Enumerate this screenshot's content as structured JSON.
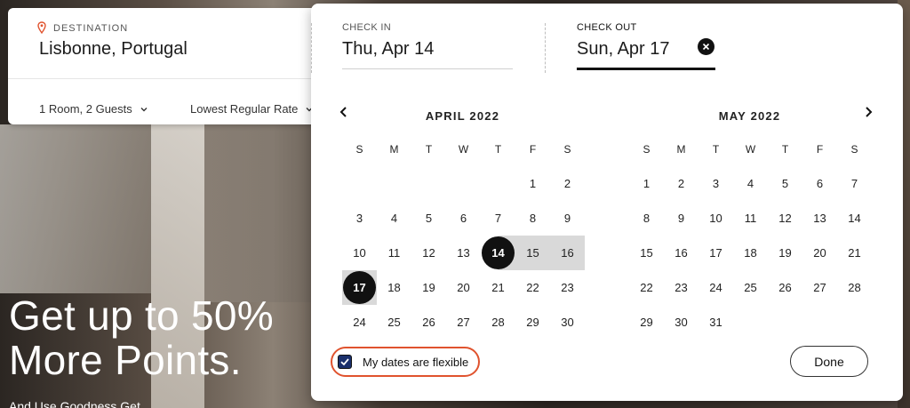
{
  "search": {
    "destination_label": "DESTINATION",
    "destination_value": "Lisbonne, Portugal",
    "rooms_guests": "1 Room, 2 Guests",
    "rate": "Lowest Regular Rate"
  },
  "hero": {
    "line1": "Get up to 50%",
    "line2": "More Points.",
    "sub": "And Use Goodness Get..."
  },
  "picker": {
    "check_in_label": "CHECK IN",
    "check_in_value": "Thu, Apr 14",
    "check_out_label": "CHECK OUT",
    "check_out_value": "Sun, Apr 17",
    "months": [
      {
        "title": "APRIL 2022",
        "weekdays": [
          "S",
          "M",
          "T",
          "W",
          "T",
          "F",
          "S"
        ],
        "weeks": [
          [
            "",
            "",
            "",
            "",
            "",
            "1",
            "2"
          ],
          [
            "3",
            "4",
            "5",
            "6",
            "7",
            "8",
            "9"
          ],
          [
            "10",
            "11",
            "12",
            "13",
            "14",
            "15",
            "16"
          ],
          [
            "17",
            "18",
            "19",
            "20",
            "21",
            "22",
            "23"
          ],
          [
            "24",
            "25",
            "26",
            "27",
            "28",
            "29",
            "30"
          ]
        ]
      },
      {
        "title": "MAY 2022",
        "weekdays": [
          "S",
          "M",
          "T",
          "W",
          "T",
          "F",
          "S"
        ],
        "weeks": [
          [
            "1",
            "2",
            "3",
            "4",
            "5",
            "6",
            "7"
          ],
          [
            "8",
            "9",
            "10",
            "11",
            "12",
            "13",
            "14"
          ],
          [
            "15",
            "16",
            "17",
            "18",
            "19",
            "20",
            "21"
          ],
          [
            "22",
            "23",
            "24",
            "25",
            "26",
            "27",
            "28"
          ],
          [
            "29",
            "30",
            "31",
            "",
            "",
            "",
            ""
          ]
        ]
      }
    ],
    "flexible_label": "My dates are flexible",
    "flexible_checked": true,
    "done_label": "Done",
    "accent_color": "#e0532e",
    "checkbox_color": "#1a2f6b"
  }
}
